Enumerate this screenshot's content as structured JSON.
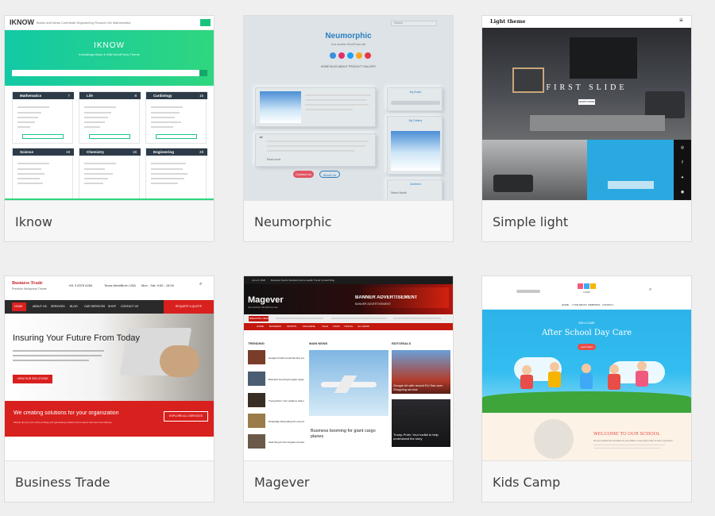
{
  "gallery": {
    "cards": [
      {
        "caption": "Iknow"
      },
      {
        "caption": "Neumorphic"
      },
      {
        "caption": "Simple light"
      },
      {
        "caption": "Business Trade"
      },
      {
        "caption": "Magever"
      },
      {
        "caption": "Kids Camp"
      }
    ]
  },
  "iknow": {
    "logo": "IKNOW",
    "nav": "Books and Ideas   Contribute   Engineering   Finance   Life   Mathematics",
    "hero_title": "IKNOW",
    "hero_subtitle": "Knowledge Base & Wiki WordPress Theme",
    "boxes": [
      {
        "label": "Mathematics",
        "count": "7"
      },
      {
        "label": "Life",
        "count": "8"
      },
      {
        "label": "Cardiology",
        "count": "15"
      },
      {
        "label": "Science",
        "count": "19"
      },
      {
        "label": "Chemistry",
        "count": "19"
      },
      {
        "label": "Engineering",
        "count": "28"
      }
    ],
    "view_all": "View all"
  },
  "neumorphic": {
    "title": "Neumorphic",
    "subtitle": "Just another WordPress site",
    "search_placeholder": "Search",
    "nav": "HOME   BLOG   ABOUT   PRODUCT   GALLERY",
    "sidebar_audio": "My Audio",
    "sidebar_gallery": "My Gallery",
    "sidebar_archives": "Archives",
    "select_month": "Select Month",
    "read_more": "Read more",
    "contact_btn": "Contact Us",
    "about_btn": "About Us"
  },
  "simple_light": {
    "logo": "Light theme",
    "slide_title": "FIRST SLIDE",
    "slide_button": "LEARN MORE"
  },
  "business_trade": {
    "logo": "Business Trade",
    "tagline": "Premium Wordpress Theme",
    "phone": "+61 3 8376 6284",
    "address": "Texas WestBirvin USA",
    "hours": "Mon - Sat: 9:00 - 18:00",
    "nav": [
      "HOME",
      "ABOUT US",
      "SERVICES",
      "BLOG",
      "OUR SERVICES",
      "SHOP",
      "CONTACT US"
    ],
    "quote_btn": "REQUEST A QUOTE",
    "hero_title": "Insuring Your Future From Today",
    "hero_text": "From banking and insurance to wealth management and securities distribution, we dedicated financial services the teams serve all major sectors.",
    "hero_btn": "VIEW OUR SOLUTIONS",
    "banner_title": "We creating solutions for your organization",
    "banner_text": "Simply dummy text of the printing and typesetting industry lorem Ipsum has been the industry.",
    "banner_btn": "EXPLORE ALL SERVICES"
  },
  "magever": {
    "top_date": "June 6, 2020",
    "top_links": "Business  Sports  Standard  Home  Health  Travel  Contact  Blog",
    "logo": "Magever",
    "tagline": "Just another WordPress site",
    "banner_1": "BANNER ADVERTISEMENT",
    "banner_2": "BANNER ADVERTISEMENT",
    "breaking": "BREAKING NEWS",
    "nav": [
      "HOME",
      "BUSINESS",
      "SPORTS",
      "MAGAZINE",
      "TECH",
      "FOOD",
      "TRAVEL",
      "ALL NEWS"
    ],
    "trending": "TRENDING",
    "main_news": "MAIN NEWS",
    "editorials": "EDITORIALS",
    "left_items": [
      "Google hit with record EU fine over Shopping service",
      "Business booming for giant cargo planes",
      "Trump-Putin: Your toolkit to help understand the story",
      "Drastically Streamlined & Loves the cutest Books",
      "Searching for the forgotten heroes of World War Two"
    ],
    "main_title": "Business booming for giant cargo planes",
    "right_1": "Google hit with record EU fine over Shopping service",
    "right_2": "Trump-Putin: Your toolkit to help understand the story"
  },
  "kids_camp": {
    "logo_sub": "CAMP",
    "nav": [
      "HOME",
      "TYPE ABOUT",
      "WEBSITES",
      "CONTACT"
    ],
    "welcome": "WELCOME",
    "hero_title": "After School Day Care",
    "hero_btn": "Learn More",
    "school_title": "WELCOME TO OUR SCHOOL",
    "school_text": "We are provided best education for your children. Lorem ipsum dolor sit amet, consectetur adipiscing elit."
  },
  "colors": {
    "ik_green": "#19c37d",
    "nm_blue": "#2b7fc1",
    "bt_red": "#d8201e",
    "mg_red": "#c3190f",
    "kc_sky": "#2cb3e9"
  }
}
